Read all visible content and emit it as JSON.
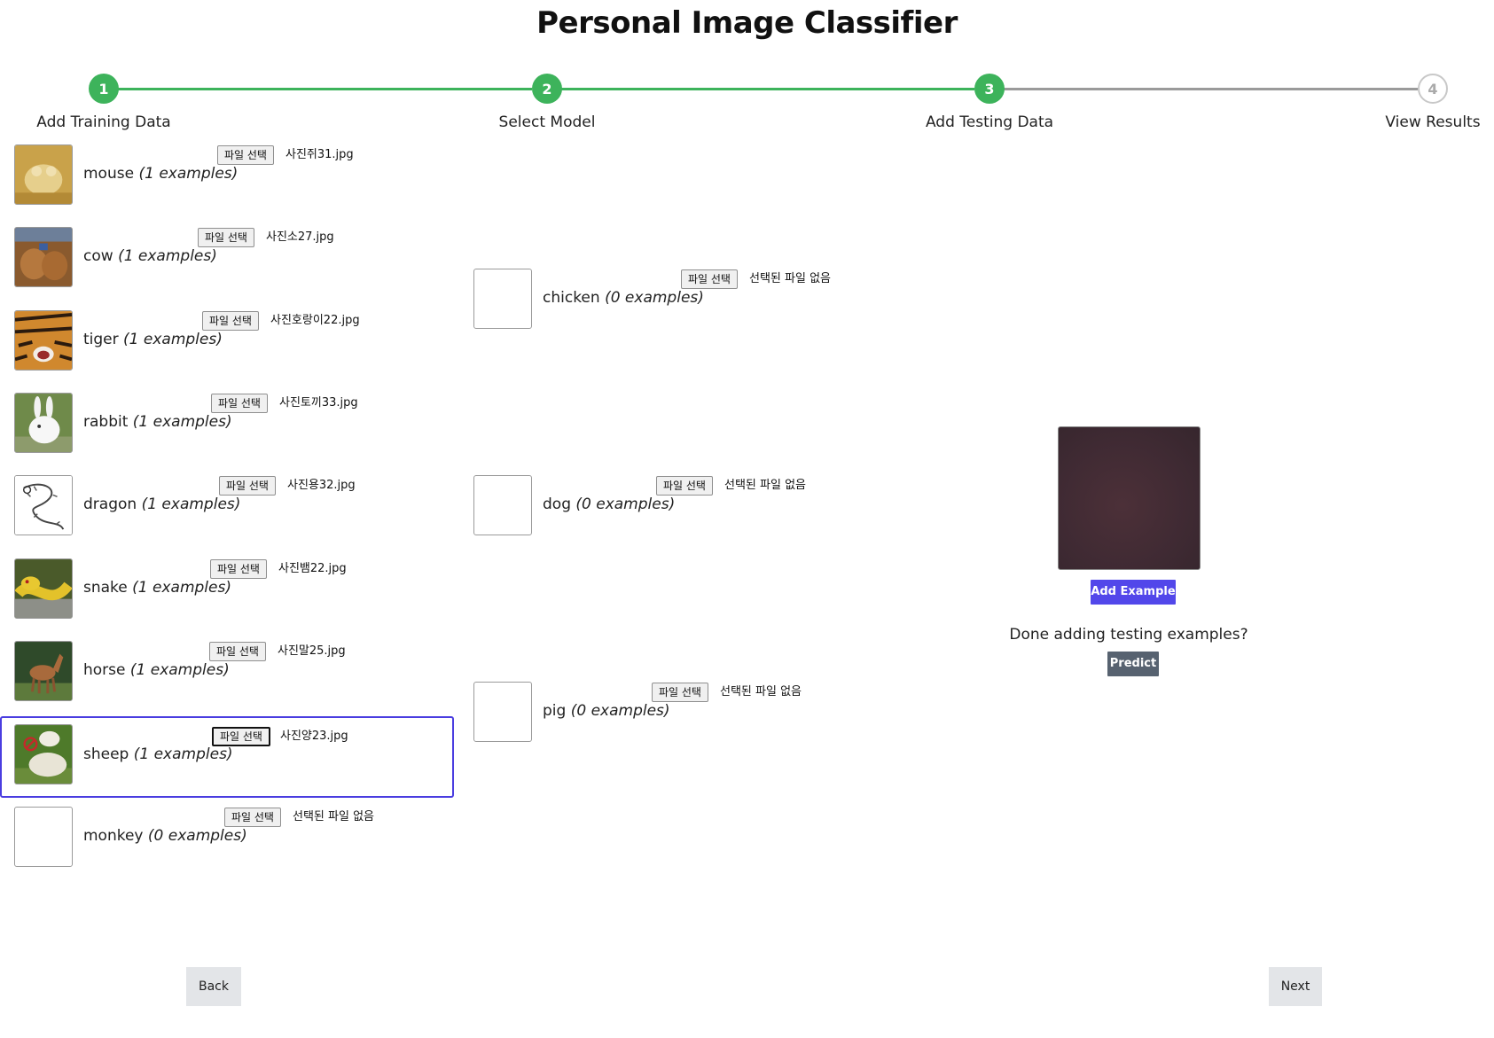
{
  "app": {
    "title": "Personal Image Classifier"
  },
  "stepper": {
    "steps": [
      {
        "number": "1",
        "label": "Add Training Data",
        "status": "done"
      },
      {
        "number": "2",
        "label": "Select Model",
        "status": "done"
      },
      {
        "number": "3",
        "label": "Add Testing Data",
        "status": "current"
      },
      {
        "number": "4",
        "label": "View Results",
        "status": "todo"
      }
    ],
    "active_color": "#3db35b",
    "inactive_color": "#999999"
  },
  "labels": [
    {
      "name": "mouse",
      "count": "(1 examples)",
      "button": "파일 선택",
      "file": "사진쥐31.jpg",
      "icon": "mouse-photo"
    },
    {
      "name": "cow",
      "count": "(1 examples)",
      "button": "파일 선택",
      "file": "사진소27.jpg",
      "icon": "cow-photo"
    },
    {
      "name": "tiger",
      "count": "(1 examples)",
      "button": "파일 선택",
      "file": "사진호랑이22.jpg",
      "icon": "tiger-photo"
    },
    {
      "name": "rabbit",
      "count": "(1 examples)",
      "button": "파일 선택",
      "file": "사진토끼33.jpg",
      "icon": "rabbit-photo"
    },
    {
      "name": "dragon",
      "count": "(1 examples)",
      "button": "파일 선택",
      "file": "사진용32.jpg",
      "icon": "dragon-drawing"
    },
    {
      "name": "snake",
      "count": "(1 examples)",
      "button": "파일 선택",
      "file": "사진뱀22.jpg",
      "icon": "snake-photo"
    },
    {
      "name": "horse",
      "count": "(1 examples)",
      "button": "파일 선택",
      "file": "사진말25.jpg",
      "icon": "horse-photo"
    },
    {
      "name": "sheep",
      "count": "(1 examples)",
      "button": "파일 선택",
      "file": "사진양23.jpg",
      "icon": "sheep-photo",
      "selected": true
    },
    {
      "name": "monkey",
      "count": "(0 examples)",
      "button": "파일 선택",
      "file": "선택된 파일 없음",
      "icon": "empty"
    },
    {
      "name": "chicken",
      "count": "(0 examples)",
      "button": "파일 선택",
      "file": "선택된 파일 없음",
      "icon": "empty"
    },
    {
      "name": "dog",
      "count": "(0 examples)",
      "button": "파일 선택",
      "file": "선택된 파일 없음",
      "icon": "empty"
    },
    {
      "name": "pig",
      "count": "(0 examples)",
      "button": "파일 선택",
      "file": "선택된 파일 없음",
      "icon": "empty"
    }
  ],
  "testing": {
    "add_example_label": "Add Example",
    "done_prompt": "Done adding testing examples?",
    "predict_label": "Predict",
    "accent": "#5247ea"
  },
  "nav": {
    "back_label": "Back",
    "next_label": "Next"
  }
}
